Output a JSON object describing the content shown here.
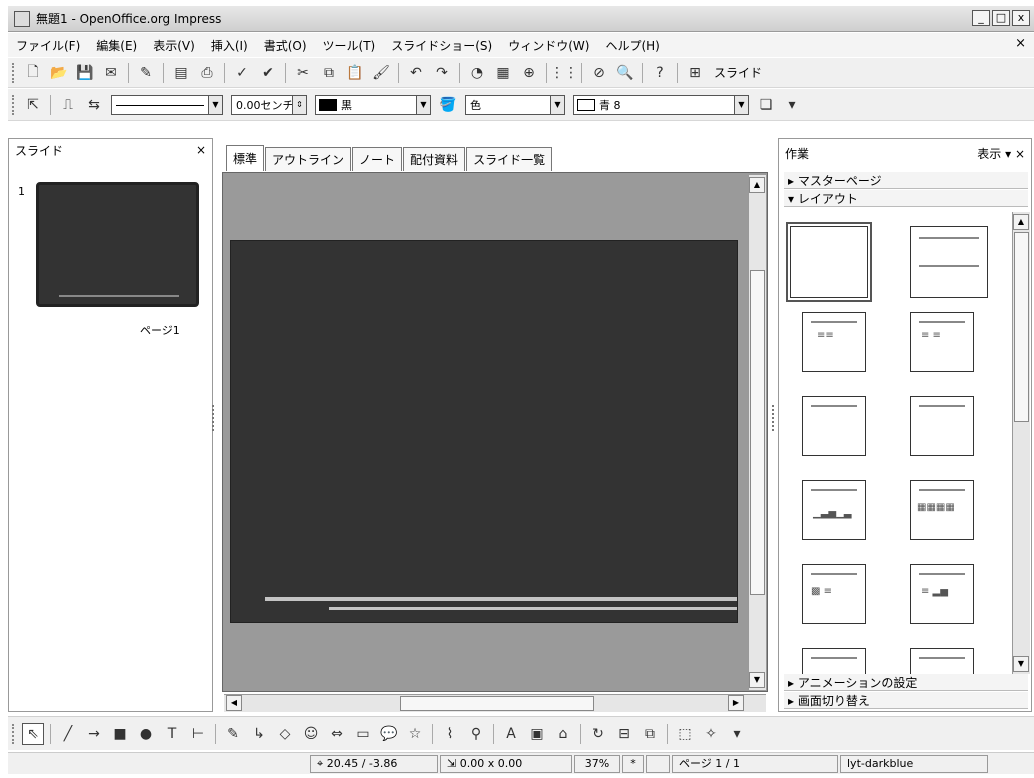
{
  "window": {
    "title": "無題1 - OpenOffice.org Impress",
    "minimize": "_",
    "maximize": "□",
    "close": "x"
  },
  "menu": {
    "items": [
      "ファイル(F)",
      "編集(E)",
      "表示(V)",
      "挿入(I)",
      "書式(O)",
      "ツール(T)",
      "スライドショー(S)",
      "ウィンドウ(W)",
      "ヘルプ(H)"
    ],
    "close": "×"
  },
  "toolbar1": {
    "slide_button": "スライド"
  },
  "toolbar2": {
    "line_width": "0.00センチ",
    "line_color": "黒",
    "area_style": "色",
    "area_color": "青 8"
  },
  "slides_pane": {
    "title": "スライド",
    "close": "×",
    "slide_number": "1",
    "slide_label": "ページ1"
  },
  "tabs": [
    "標準",
    "アウトライン",
    "ノート",
    "配付資料",
    "スライド一覧"
  ],
  "tasks_pane": {
    "title": "作業",
    "view_menu": "表示 ▾",
    "close": "×",
    "sections": {
      "master_pages": "▸ マスターページ",
      "layouts": "▾ レイアウト",
      "animation": "▸ アニメーションの設定",
      "transition": "▸ 画面切り替え"
    }
  },
  "status": {
    "position": "20.45 / -3.86",
    "size": "0.00 x 0.00",
    "zoom": "37%",
    "modified": "*",
    "page": "ページ 1 / 1",
    "master": "lyt-darkblue"
  },
  "colors": {
    "slide_bg": "#333333",
    "work_bg": "#9a9a9a"
  }
}
